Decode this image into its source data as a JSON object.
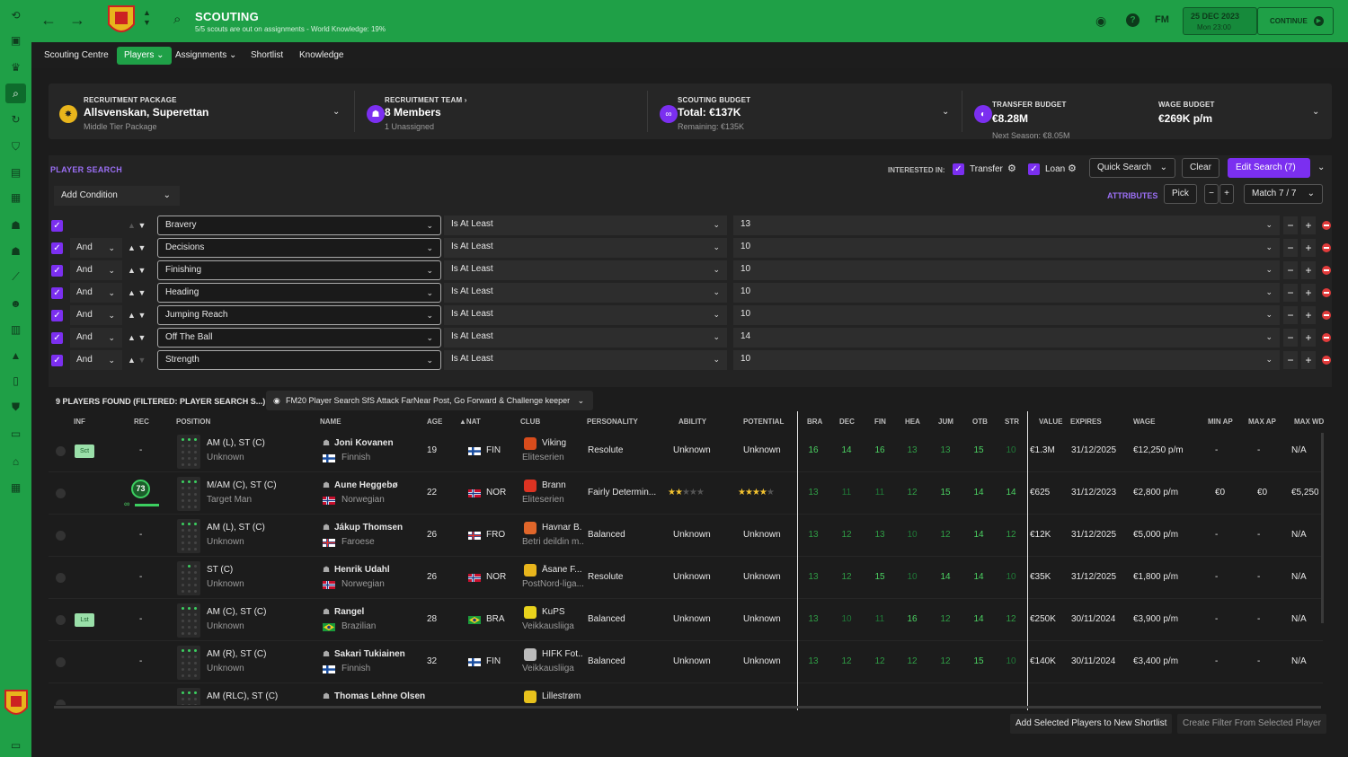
{
  "header": {
    "title": "SCOUTING",
    "subtitle": "5/5 scouts are out on assignments - World Knowledge: 19%",
    "date": "25 DEC 2023",
    "time": "Mon 23:00",
    "fm_label": "FM",
    "continue_label": "CONTINUE"
  },
  "nav": {
    "items": [
      {
        "label": "Scouting Centre"
      },
      {
        "label": "Players ⌄"
      },
      {
        "label": "Assignments ⌄"
      },
      {
        "label": "Shortlist"
      },
      {
        "label": "Knowledge"
      }
    ]
  },
  "budget": {
    "package_label": "RECRUITMENT PACKAGE",
    "package_value": "Allsvenskan, Superettan",
    "package_sub": "Middle Tier Package",
    "team_label": "RECRUITMENT TEAM ›",
    "team_value": "8 Members",
    "team_sub": "1 Unassigned",
    "scouting_label": "SCOUTING BUDGET",
    "scouting_value": "Total: €137K",
    "scouting_sub": "Remaining: €135K",
    "transfer_label": "TRANSFER BUDGET",
    "transfer_value": "€8.28M",
    "transfer_sub": "Next Season: €8.05M",
    "wage_label": "WAGE BUDGET",
    "wage_value": "€269K p/m"
  },
  "search": {
    "title": "PLAYER SEARCH",
    "interested_label": "INTERESTED IN:",
    "transfer_label": "Transfer",
    "loan_label": "Loan",
    "quick_search": "Quick Search",
    "clear": "Clear",
    "edit_search": "Edit Search (7)",
    "add_condition": "Add Condition",
    "attributes_label": "ATTRIBUTES",
    "pick": "Pick",
    "match": "Match 7 / 7",
    "conditions": [
      {
        "joiner": "",
        "attribute": "Bravery",
        "operator": "Is At Least",
        "value": "13"
      },
      {
        "joiner": "And",
        "attribute": "Decisions",
        "operator": "Is At Least",
        "value": "10"
      },
      {
        "joiner": "And",
        "attribute": "Finishing",
        "operator": "Is At Least",
        "value": "10"
      },
      {
        "joiner": "And",
        "attribute": "Heading",
        "operator": "Is At Least",
        "value": "10"
      },
      {
        "joiner": "And",
        "attribute": "Jumping Reach",
        "operator": "Is At Least",
        "value": "10"
      },
      {
        "joiner": "And",
        "attribute": "Off The Ball",
        "operator": "Is At Least",
        "value": "14"
      },
      {
        "joiner": "And",
        "attribute": "Strength",
        "operator": "Is At Least",
        "value": "10"
      }
    ]
  },
  "results": {
    "title": "9 PLAYERS FOUND (FILTERED: PLAYER SEARCH S...)",
    "filter": "FM20 Player Search SfS Attack FarNear Post, Go Forward & Challenge keeper",
    "columns": [
      "INF",
      "REC",
      "POSITION",
      "NAME",
      "AGE",
      "▲NAT",
      "CLUB",
      "PERSONALITY",
      "ABILITY",
      "POTENTIAL",
      "BRA",
      "DEC",
      "FIN",
      "HEA",
      "JUM",
      "OTB",
      "STR",
      "VALUE",
      "EXPIRES",
      "WAGE",
      "MIN AP",
      "MAX AP",
      "MAX WD"
    ],
    "rows": [
      {
        "badge": "Sct",
        "rec": "-",
        "pos": "AM (L), ST (C)",
        "role": "Unknown",
        "name": "Joni Kovanen",
        "natl": "Finnish",
        "age": "19",
        "nat": "FIN",
        "club": "Viking",
        "league": "Eliteserien",
        "pers": "Resolute",
        "ability": "Unknown",
        "potential": "Unknown",
        "attrs": [
          "16",
          "14",
          "16",
          "13",
          "13",
          "15",
          "10"
        ],
        "value": "€1.3M",
        "expires": "31/12/2025",
        "wage": "€12,250 p/m",
        "minap": "-",
        "maxap": "-",
        "maxwd": "N/A"
      },
      {
        "badge": "",
        "rec": "73",
        "pos": "M/AM (C), ST (C)",
        "role": "Target Man",
        "name": "Aune Heggebø",
        "natl": "Norwegian",
        "age": "22",
        "nat": "NOR",
        "club": "Brann",
        "league": "Eliteserien",
        "pers": "Fairly Determin...",
        "ability": "",
        "potential": "",
        "attrs": [
          "13",
          "11",
          "11",
          "12",
          "15",
          "14",
          "14"
        ],
        "value": "€625",
        "expires": "31/12/2023",
        "wage": "€2,800 p/m",
        "minap": "€0",
        "maxap": "€0",
        "maxwd": "€5,250 p"
      },
      {
        "badge": "",
        "rec": "-",
        "pos": "AM (L), ST (C)",
        "role": "Unknown",
        "name": "Jákup Thomsen",
        "natl": "Faroese",
        "age": "26",
        "nat": "FRO",
        "club": "Havnar B...",
        "league": "Betri deildin m...",
        "pers": "Balanced",
        "ability": "Unknown",
        "potential": "Unknown",
        "attrs": [
          "13",
          "12",
          "13",
          "10",
          "12",
          "14",
          "12"
        ],
        "value": "€12K",
        "expires": "31/12/2025",
        "wage": "€5,000 p/m",
        "minap": "-",
        "maxap": "-",
        "maxwd": "N/A"
      },
      {
        "badge": "",
        "rec": "-",
        "pos": "ST (C)",
        "role": "Unknown",
        "name": "Henrik Udahl",
        "natl": "Norwegian",
        "age": "26",
        "nat": "NOR",
        "club": "Åsane F...",
        "league": "PostNord-liga...",
        "pers": "Resolute",
        "ability": "Unknown",
        "potential": "Unknown",
        "attrs": [
          "13",
          "12",
          "15",
          "10",
          "14",
          "14",
          "10"
        ],
        "value": "€35K",
        "expires": "31/12/2025",
        "wage": "€1,800 p/m",
        "minap": "-",
        "maxap": "-",
        "maxwd": "N/A"
      },
      {
        "badge": "Lst",
        "rec": "-",
        "pos": "AM (C), ST (C)",
        "role": "Unknown",
        "name": "Rangel",
        "natl": "Brazilian",
        "age": "28",
        "nat": "BRA",
        "club": "KuPS",
        "league": "Veikkausliiga",
        "pers": "Balanced",
        "ability": "Unknown",
        "potential": "Unknown",
        "attrs": [
          "13",
          "10",
          "11",
          "16",
          "12",
          "14",
          "12"
        ],
        "value": "€250K",
        "expires": "30/11/2024",
        "wage": "€3,900 p/m",
        "minap": "-",
        "maxap": "-",
        "maxwd": "N/A"
      },
      {
        "badge": "",
        "rec": "-",
        "pos": "AM (R), ST (C)",
        "role": "Unknown",
        "name": "Sakari Tukiainen",
        "natl": "Finnish",
        "age": "32",
        "nat": "FIN",
        "club": "HIFK Fot...",
        "league": "Veikkausliiga",
        "pers": "Balanced",
        "ability": "Unknown",
        "potential": "Unknown",
        "attrs": [
          "13",
          "12",
          "12",
          "12",
          "12",
          "15",
          "10"
        ],
        "value": "€140K",
        "expires": "30/11/2024",
        "wage": "€3,400 p/m",
        "minap": "-",
        "maxap": "-",
        "maxwd": "N/A"
      },
      {
        "badge": "",
        "rec": "",
        "pos": "AM (RLC), ST (C)",
        "role": "",
        "name": "Thomas Lehne Olsen",
        "natl": "",
        "age": "",
        "nat": "",
        "club": "Lillestrøm",
        "league": "",
        "pers": "",
        "ability": "",
        "potential": "",
        "attrs": [
          "",
          "",
          "",
          "",
          "",
          "",
          ""
        ],
        "value": "",
        "expires": "",
        "wage": "",
        "minap": "",
        "maxap": "",
        "maxwd": ""
      }
    ],
    "star_ratings": {
      "ability": 2,
      "potential": 3.5,
      "max": 5
    }
  },
  "footer": {
    "add_shortlist": "Add Selected Players to New Shortlist",
    "create_filter": "Create Filter From Selected Player"
  },
  "colors": {
    "accent_green": "#1fa047",
    "purple": "#7b2ff0",
    "attr_high": "#4bd262"
  }
}
